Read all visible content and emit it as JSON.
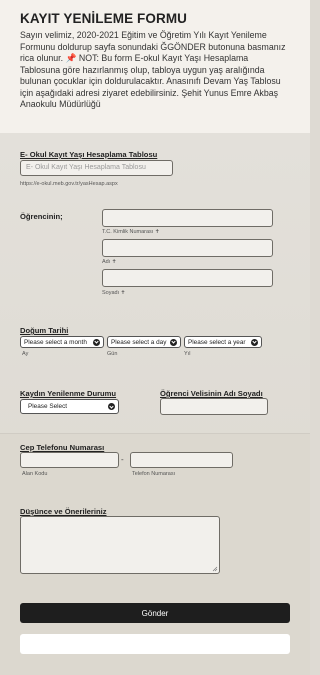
{
  "header": {
    "title": "KAYIT YENİLEME FORMU",
    "description": "Sayın velimiz, 2020-2021 Eğitim ve Öğretim Yılı Kayıt Yenileme Formunu doldurup sayfa sonundaki ĞGÖNDER butonuna basmanız rica olunur. 📌 NOT: Bu form E-okul Kayıt Yaşı Hesaplama Tablosuna göre hazırlanmış olup, tabloya uygun yaş aralığında bulunan çocuklar için doldurulacaktır. Anasınıfı Devam Yaş Tablosu için aşağıdaki adresi ziyaret edebilirsiniz. Şehit Yunus Emre Akbaş Anaokulu Müdürlüğü"
  },
  "eokul": {
    "label": "E- Okul Kayıt Yaşı Hesaplama Tablosu",
    "placeholder": "E- Okul Kayıt Yaşı Hesaplama Tablosu",
    "url": "https://e-okul.meb.gov.tr/yasHesap.aspx"
  },
  "student": {
    "label": "Öğrencinin;",
    "tc_sub": "T.C. Kimlik Numarası ✝",
    "name_sub": "Adı ✝",
    "surname_sub": "Soyadı ✝"
  },
  "birth": {
    "label": "Doğum Tarihi",
    "month": "Please select a month",
    "day": "Please select a day",
    "year": "Please select a year",
    "month_sub": "Ay",
    "day_sub": "Gün",
    "year_sub": "Yıl"
  },
  "renewal": {
    "label": "Kaydın Yenilenme Durumu",
    "select": "Please Select"
  },
  "parent": {
    "label": "Öğrenci Velisinin Adı Soyadı"
  },
  "phone": {
    "label": "Cep Telefonu Numarası",
    "dash": "-",
    "area_sub": "Alan Kodu",
    "number_sub": "Telefon Numarası"
  },
  "comments": {
    "label": "Düşünce ve Önerileriniz"
  },
  "submit": {
    "label": "Gönder"
  }
}
